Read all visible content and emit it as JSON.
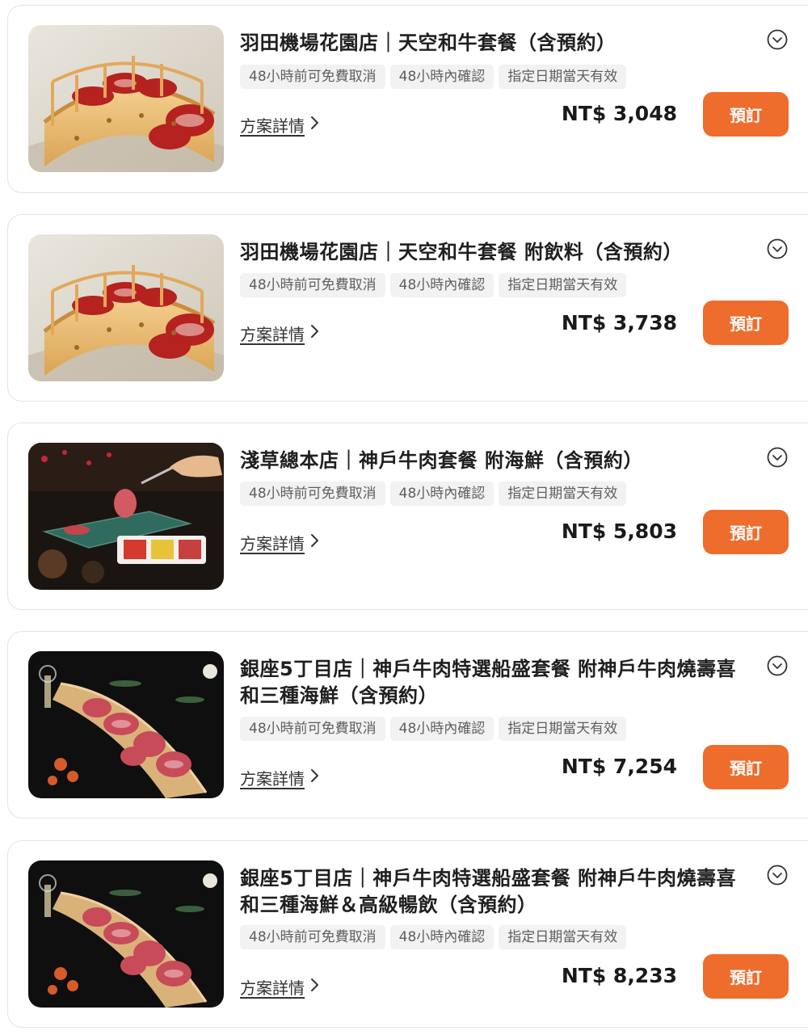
{
  "tags": [
    "48小時前可免費取消",
    "48小時內確認",
    "指定日期當天有效"
  ],
  "detail_label": "方案詳情",
  "book_label": "預訂",
  "accent_color": "#ee6c2c",
  "plans": [
    {
      "title": "羽田機場花園店｜天空和牛套餐（含預約）",
      "price": "NT$ 3,048",
      "image": "wagyu-bridge-platter"
    },
    {
      "title": "羽田機場花園店｜天空和牛套餐 附飲料（含預約）",
      "price": "NT$ 3,738",
      "image": "wagyu-bridge-platter"
    },
    {
      "title": "淺草總本店｜神戶牛肉套餐 附海鮮（含預約）",
      "price": "NT$ 5,803",
      "image": "kobe-beef-tongs"
    },
    {
      "title": "銀座5丁目店｜神戶牛肉特選船盛套餐 附神戶牛肉燒壽喜和三種海鮮（含預約）",
      "price": "NT$ 7,254",
      "image": "kobe-boat-platter"
    },
    {
      "title": "銀座5丁目店｜神戶牛肉特選船盛套餐 附神戶牛肉燒壽喜和三種海鮮＆高級暢飲（含預約）",
      "price": "NT$ 8,233",
      "image": "kobe-boat-platter"
    }
  ]
}
